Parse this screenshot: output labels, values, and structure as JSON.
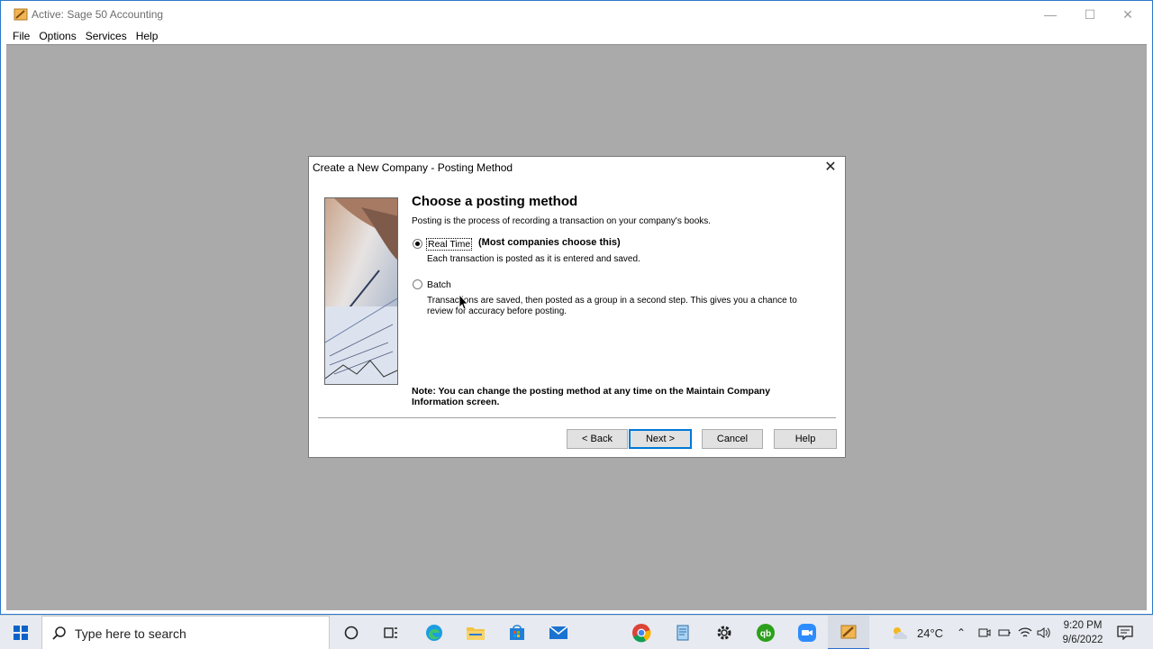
{
  "app": {
    "title": "Active: Sage 50 Accounting",
    "menu": [
      "File",
      "Options",
      "Services",
      "Help"
    ]
  },
  "dialog": {
    "title": "Create a New Company - Posting Method",
    "heading": "Choose a posting method",
    "subtext": "Posting is the process of recording a transaction on your company's books.",
    "options": {
      "real_time": {
        "label": "Real Time",
        "note": "(Most companies choose this)",
        "description": "Each transaction is posted as it is entered and saved.",
        "selected": true
      },
      "batch": {
        "label": "Batch",
        "description": "Transactions are saved, then posted as a group in a second step.  This gives you a chance to review for accuracy before posting.",
        "selected": false
      }
    },
    "note": "Note:  You can change the posting method at any time on the Maintain Company Information screen.",
    "buttons": {
      "back": "< Back",
      "next": "Next >",
      "cancel": "Cancel",
      "help": "Help"
    }
  },
  "taskbar": {
    "search_placeholder": "Type here to search",
    "temperature": "24°C",
    "time": "9:20 PM",
    "date": "9/6/2022"
  },
  "colors": {
    "workspace": "#aaaaaa",
    "accent": "#0078d7",
    "taskbar": "#e7eaf0"
  }
}
